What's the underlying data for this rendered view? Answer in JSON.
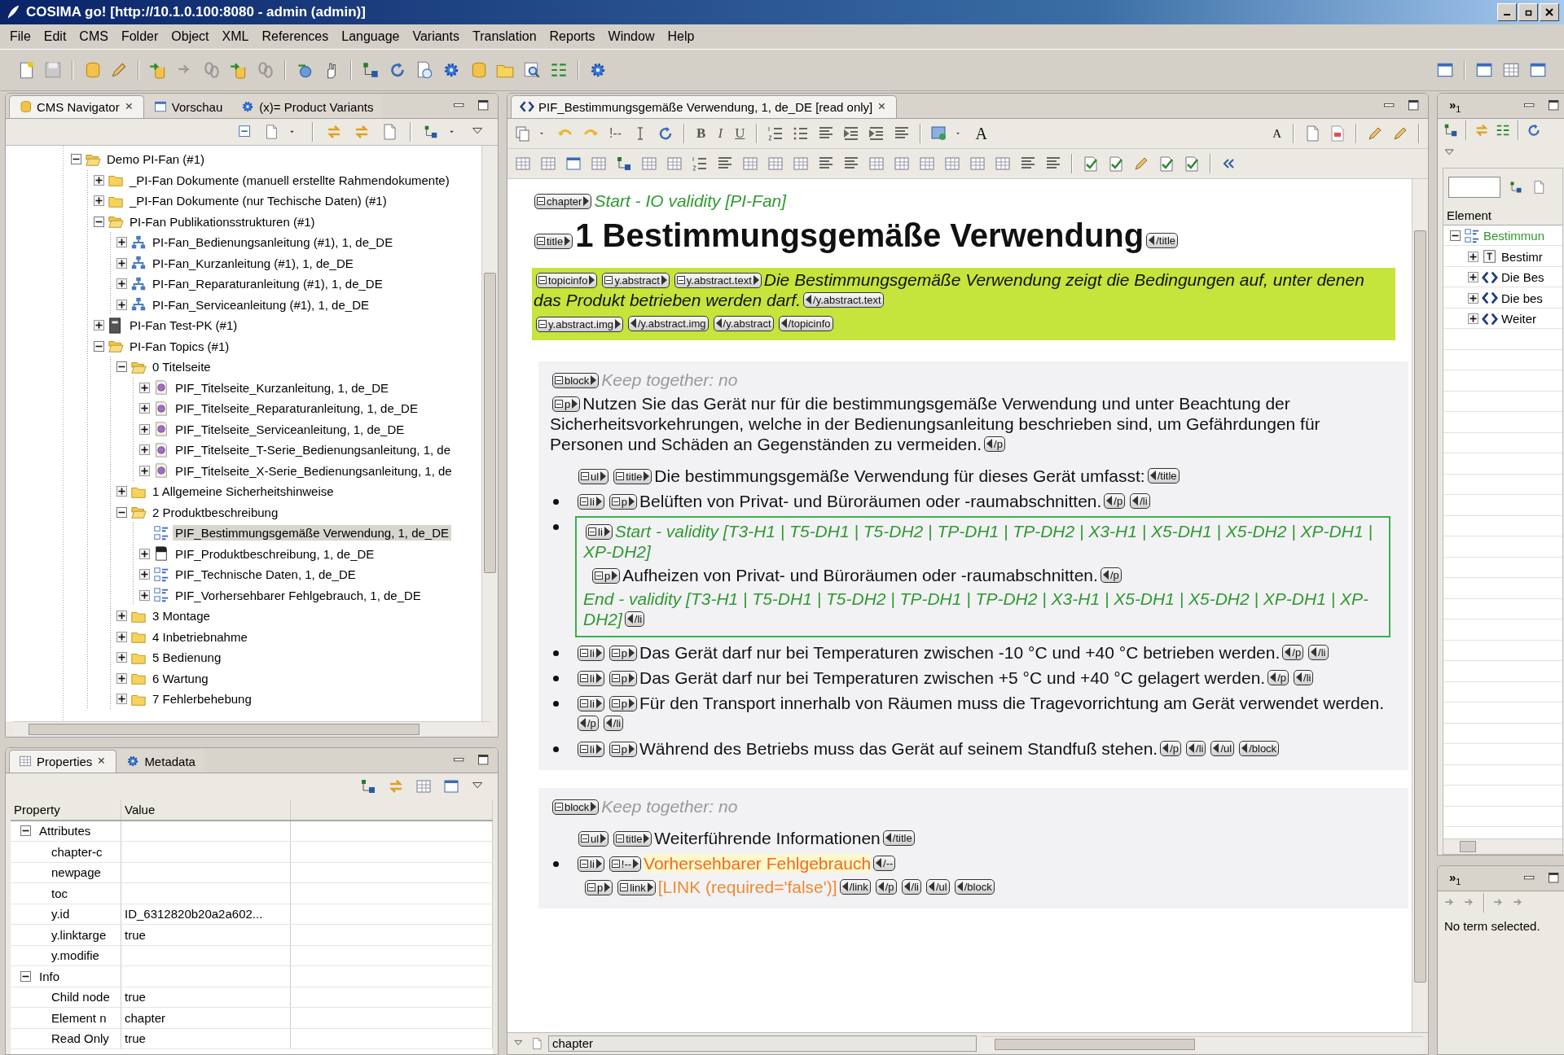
{
  "window": {
    "title": "COSIMA go! [http://10.1.0.100:8080 - admin (admin)]"
  },
  "menu": [
    "File",
    "Edit",
    "CMS",
    "Folder",
    "Object",
    "XML",
    "References",
    "Language",
    "Variants",
    "Translation",
    "Reports",
    "Window",
    "Help"
  ],
  "navigator": {
    "tabs": [
      {
        "label": "CMS Navigator",
        "selected": true
      },
      {
        "label": "Vorschau",
        "selected": false
      },
      {
        "label": "(x)= Product Variants",
        "selected": false
      }
    ],
    "tree": [
      {
        "label": "Demo PI-Fan (#1)",
        "kind": "folder",
        "expandable": true,
        "expanded": true,
        "selected": false,
        "children": [
          {
            "label": "_PI-Fan Dokumente (manuell erstellte Rahmendokumente)",
            "kind": "folder",
            "expandable": true,
            "expanded": false,
            "selected": false
          },
          {
            "label": "_PI-Fan Dokumente (nur Techische Daten) (#1)",
            "kind": "folder",
            "expandable": true,
            "expanded": false,
            "selected": false
          },
          {
            "label": "PI-Fan Publikationsstrukturen (#1)",
            "kind": "folder",
            "expandable": true,
            "expanded": true,
            "selected": false,
            "children": [
              {
                "label": "PI-Fan_Bedienungsanleitung (#1), 1, de_DE",
                "kind": "structure",
                "expandable": true,
                "expanded": false,
                "selected": false
              },
              {
                "label": "PI-Fan_Kurzanleitung (#1), 1, de_DE",
                "kind": "structure",
                "expandable": true,
                "expanded": false,
                "selected": false
              },
              {
                "label": "PI-Fan_Reparaturanleitung (#1), 1, de_DE",
                "kind": "structure",
                "expandable": true,
                "expanded": false,
                "selected": false
              },
              {
                "label": "PI-Fan_Serviceanleitung (#1), 1, de_DE",
                "kind": "structure",
                "expandable": true,
                "expanded": false,
                "selected": false
              }
            ]
          },
          {
            "label": "PI-Fan Test-PK (#1)",
            "kind": "binder",
            "expandable": true,
            "expanded": false,
            "selected": false
          },
          {
            "label": "PI-Fan Topics (#1)",
            "kind": "folder",
            "expandable": true,
            "expanded": true,
            "selected": false,
            "children": [
              {
                "label": "0 Titelseite",
                "kind": "folder",
                "expandable": true,
                "expanded": true,
                "selected": false,
                "children": [
                  {
                    "label": "PIF_Titelseite_Kurzanleitung, 1, de_DE",
                    "kind": "topic",
                    "expandable": true,
                    "expanded": false,
                    "selected": false
                  },
                  {
                    "label": "PIF_Titelseite_Reparaturanleitung, 1, de_DE",
                    "kind": "topic",
                    "expandable": true,
                    "expanded": false,
                    "selected": false
                  },
                  {
                    "label": "PIF_Titelseite_Serviceanleitung, 1, de_DE",
                    "kind": "topic",
                    "expandable": true,
                    "expanded": false,
                    "selected": false
                  },
                  {
                    "label": "PIF_Titelseite_T-Serie_Bedienungsanleitung, 1, de",
                    "kind": "topic",
                    "expandable": true,
                    "expanded": false,
                    "selected": false
                  },
                  {
                    "label": "PIF_Titelseite_X-Serie_Bedienungsanleitung, 1, de",
                    "kind": "topic",
                    "expandable": true,
                    "expanded": false,
                    "selected": false
                  }
                ]
              },
              {
                "label": "1 Allgemeine Sicherheitshinweise",
                "kind": "folder",
                "expandable": true,
                "expanded": false,
                "selected": false
              },
              {
                "label": "2 Produktbeschreibung",
                "kind": "folder",
                "expandable": true,
                "expanded": true,
                "selected": false,
                "children": [
                  {
                    "label": "PIF_Bestimmungsgemäße Verwendung, 1, de_DE",
                    "kind": "outline",
                    "expandable": false,
                    "selected": true
                  },
                  {
                    "label": "PIF_Produktbeschreibung, 1, de_DE",
                    "kind": "document",
                    "expandable": true,
                    "expanded": false,
                    "selected": false
                  },
                  {
                    "label": "PIF_Technische Daten, 1, de_DE",
                    "kind": "outline",
                    "expandable": true,
                    "expanded": false,
                    "selected": false
                  },
                  {
                    "label": "PIF_Vorhersehbarer Fehlgebrauch, 1, de_DE",
                    "kind": "outline",
                    "expandable": true,
                    "expanded": false,
                    "selected": false
                  }
                ]
              },
              {
                "label": "3 Montage",
                "kind": "folder",
                "expandable": true,
                "expanded": false,
                "selected": false
              },
              {
                "label": "4 Inbetriebnahme",
                "kind": "folder",
                "expandable": true,
                "expanded": false,
                "selected": false
              },
              {
                "label": "5 Bedienung",
                "kind": "folder",
                "expandable": true,
                "expanded": false,
                "selected": false
              },
              {
                "label": "6 Wartung",
                "kind": "folder",
                "expandable": true,
                "expanded": false,
                "selected": false
              },
              {
                "label": "7 Fehlerbehebung",
                "kind": "folder",
                "expandable": true,
                "expanded": false,
                "selected": false
              }
            ]
          }
        ]
      }
    ]
  },
  "properties": {
    "tabs": [
      {
        "label": "Properties",
        "selected": true
      },
      {
        "label": "Metadata",
        "selected": false
      }
    ],
    "columns": [
      "Property",
      "Value"
    ],
    "rows": [
      {
        "kind": "group",
        "name": "Attributes",
        "expanded": true
      },
      {
        "kind": "prop",
        "name": "chapter-c"
      },
      {
        "kind": "prop",
        "name": "newpage"
      },
      {
        "kind": "prop",
        "name": "toc"
      },
      {
        "kind": "prop",
        "name": "y.id",
        "value": "ID_6312820b20a2a602..."
      },
      {
        "kind": "prop",
        "name": "y.linktarge",
        "value": "true"
      },
      {
        "kind": "prop",
        "name": "y.modifie"
      },
      {
        "kind": "group",
        "name": "Info",
        "expanded": true
      },
      {
        "kind": "prop",
        "name": "Child node",
        "value": "true"
      },
      {
        "kind": "prop",
        "name": "Element n",
        "value": "chapter"
      },
      {
        "kind": "prop",
        "name": "Read Only",
        "value": "true"
      }
    ]
  },
  "editor": {
    "tab": {
      "label": "PIF_Bestimmungsgemäße Verwendung, 1, de_DE [read only]",
      "selected": true
    },
    "toolbar_text": [
      {
        "label": "!--",
        "kind": "comment"
      },
      {
        "label": "B",
        "kind": "bold"
      },
      {
        "label": "I",
        "kind": "italic"
      },
      {
        "label": "U",
        "kind": "underline"
      },
      {
        "label": "A",
        "kind": "grow"
      },
      {
        "label": "A",
        "kind": "shrink"
      }
    ],
    "blocks": [
      {
        "kind": "plain",
        "lines": [
          {
            "kind": "para",
            "segments": [
              {
                "kind": "open_tag",
                "label": "chapter"
              },
              {
                "kind": "condition",
                "text": "Start - IO validity [PI-Fan]"
              }
            ]
          },
          {
            "kind": "para",
            "segments": [
              {
                "kind": "open_tag",
                "label": "title"
              },
              {
                "kind": "heading",
                "text": "1 Bestimmungsgemäße Verwendung"
              },
              {
                "kind": "close_tag",
                "label": "/title"
              }
            ]
          }
        ]
      },
      {
        "kind": "abstract",
        "lines": [
          {
            "kind": "para",
            "segments": [
              {
                "kind": "open_tag",
                "label": "topicinfo"
              },
              {
                "kind": "open_tag",
                "label": "y.abstract"
              },
              {
                "kind": "open_tag",
                "label": "y.abstract.text"
              },
              {
                "kind": "abstract",
                "text": "Die Bestimmungsgemäße Verwendung zeigt die Bedingungen auf, unter denen das Produkt betrieben werden darf."
              },
              {
                "kind": "close_tag",
                "label": "/y.abstract.text"
              }
            ]
          },
          {
            "kind": "para",
            "segments": [
              {
                "kind": "open_tag",
                "label": "y.abstract.img"
              },
              {
                "kind": "close_tag",
                "label": "/y.abstract.img"
              },
              {
                "kind": "close_tag",
                "label": "/y.abstract"
              },
              {
                "kind": "close_tag",
                "label": "/topicinfo"
              }
            ]
          }
        ]
      },
      {
        "kind": "block",
        "lines": [
          {
            "kind": "para",
            "segments": [
              {
                "kind": "open_tag",
                "label": "block"
              },
              {
                "kind": "hint",
                "text": "Keep together: no"
              }
            ]
          },
          {
            "kind": "para",
            "segments": [
              {
                "kind": "open_tag",
                "label": "p"
              },
              {
                "kind": "body",
                "text": "Nutzen Sie das Gerät nur für die bestimmungsgemäße Verwendung und unter Beachtung der Sicherheitsvorkehrungen, welche in der Bedienungsanleitung beschrieben sind, um Gefährdungen für Personen und Schäden an Gegenständen zu vermeiden."
              },
              {
                "kind": "close_tag",
                "label": "/p"
              }
            ]
          },
          {
            "kind": "list_title",
            "segments": [
              {
                "kind": "open_tag",
                "label": "ul"
              },
              {
                "kind": "open_tag",
                "label": "title"
              },
              {
                "kind": "body",
                "text": "Die bestimmungsgemäße Verwendung für dieses Gerät umfasst:"
              },
              {
                "kind": "close_tag",
                "label": "/title"
              }
            ]
          },
          {
            "kind": "item",
            "segments": [
              {
                "kind": "open_tag",
                "label": "li"
              },
              {
                "kind": "open_tag",
                "label": "p"
              },
              {
                "kind": "body",
                "text": "Belüften von Privat- und Büroräumen oder -raumabschnitten."
              },
              {
                "kind": "close_tag",
                "label": "/p"
              },
              {
                "kind": "close_tag",
                "label": "/li"
              }
            ]
          },
          {
            "kind": "validity",
            "lines": [
              {
                "kind": "para",
                "segments": [
                  {
                    "kind": "open_tag",
                    "label": "li"
                  },
                  {
                    "kind": "condition",
                    "text": "Start - validity [T3-H1 | T5-DH1 | T5-DH2 | TP-DH1 | TP-DH2 | X3-H1 | X5-DH1 | X5-DH2 | XP-DH1 | XP-DH2]"
                  }
                ]
              },
              {
                "kind": "item_cont",
                "segments": [
                  {
                    "kind": "open_tag",
                    "label": "p"
                  },
                  {
                    "kind": "body",
                    "text": "Aufheizen von Privat- und Büroräumen oder -raumabschnitten."
                  },
                  {
                    "kind": "close_tag",
                    "label": "/p"
                  }
                ]
              },
              {
                "kind": "para",
                "segments": [
                  {
                    "kind": "condition",
                    "text": "End - validity [T3-H1 | T5-DH1 | T5-DH2 | TP-DH1 | TP-DH2 | X3-H1 | X5-DH1 | X5-DH2 | XP-DH1 | XP-DH2]"
                  },
                  {
                    "kind": "close_tag",
                    "label": "/li"
                  }
                ]
              }
            ]
          },
          {
            "kind": "item",
            "segments": [
              {
                "kind": "open_tag",
                "label": "li"
              },
              {
                "kind": "open_tag",
                "label": "p"
              },
              {
                "kind": "body",
                "text": "Das Gerät darf nur bei Temperaturen zwischen -10 °C und +40 °C betrieben werden."
              },
              {
                "kind": "close_tag",
                "label": "/p"
              },
              {
                "kind": "close_tag",
                "label": "/li"
              }
            ]
          },
          {
            "kind": "item",
            "segments": [
              {
                "kind": "open_tag",
                "label": "li"
              },
              {
                "kind": "open_tag",
                "label": "p"
              },
              {
                "kind": "body",
                "text": "Das Gerät darf nur bei Temperaturen zwischen +5 °C und +40 °C gelagert werden."
              },
              {
                "kind": "close_tag",
                "label": "/p"
              },
              {
                "kind": "close_tag",
                "label": "/li"
              }
            ]
          },
          {
            "kind": "item",
            "segments": [
              {
                "kind": "open_tag",
                "label": "li"
              },
              {
                "kind": "open_tag",
                "label": "p"
              },
              {
                "kind": "body",
                "text": "Für den Transport innerhalb von Räumen muss die Tragevorrichtung am Gerät verwendet werden."
              },
              {
                "kind": "close_tag",
                "label": "/p"
              },
              {
                "kind": "close_tag",
                "label": "/li"
              }
            ]
          },
          {
            "kind": "item",
            "segments": [
              {
                "kind": "open_tag",
                "label": "li"
              },
              {
                "kind": "open_tag",
                "label": "p"
              },
              {
                "kind": "body",
                "text": "Während des Betriebs muss das Gerät auf seinem Standfuß stehen."
              },
              {
                "kind": "close_tag",
                "label": "/p"
              },
              {
                "kind": "close_tag",
                "label": "/li"
              },
              {
                "kind": "close_tag",
                "label": "/ul"
              },
              {
                "kind": "close_tag",
                "label": "/block"
              }
            ]
          }
        ]
      },
      {
        "kind": "block",
        "lines": [
          {
            "kind": "para",
            "segments": [
              {
                "kind": "open_tag",
                "label": "block"
              },
              {
                "kind": "hint",
                "text": "Keep together: no"
              }
            ]
          },
          {
            "kind": "list_title",
            "segments": [
              {
                "kind": "open_tag",
                "label": "ul"
              },
              {
                "kind": "open_tag",
                "label": "title"
              },
              {
                "kind": "body",
                "text": "Weiterführende Informationen"
              },
              {
                "kind": "close_tag",
                "label": "/title"
              }
            ]
          },
          {
            "kind": "item",
            "segments": [
              {
                "kind": "open_tag",
                "label": "li"
              },
              {
                "kind": "open_tag",
                "label": "!--"
              },
              {
                "kind": "comment",
                "text": "Vorhersehbarer Fehlgebrauch"
              },
              {
                "kind": "close_tag",
                "label": "/--"
              }
            ]
          },
          {
            "kind": "item_cont",
            "segments": [
              {
                "kind": "open_tag",
                "label": "p"
              },
              {
                "kind": "open_tag",
                "label": "link"
              },
              {
                "kind": "link",
                "text": "[LINK (required='false')]"
              },
              {
                "kind": "close_tag",
                "label": "/link"
              },
              {
                "kind": "close_tag",
                "label": "/p"
              },
              {
                "kind": "close_tag",
                "label": "/li"
              },
              {
                "kind": "close_tag",
                "label": "/ul"
              },
              {
                "kind": "close_tag",
                "label": "/block"
              }
            ]
          }
        ]
      }
    ],
    "breadcrumb": "chapter"
  },
  "outline": {
    "overflow": {
      "glyph": "»",
      "count": "1"
    },
    "column": "Element",
    "tree": [
      {
        "label": "Bestimmun",
        "kind": "outline",
        "expanded": true,
        "children": [
          {
            "label": "Bestimr",
            "kind": "title",
            "expanded": false
          },
          {
            "label": "Die Bes",
            "kind": "element",
            "expanded": false
          },
          {
            "label": "Die bes",
            "kind": "element",
            "expanded": false
          },
          {
            "label": "Weiter",
            "kind": "element",
            "expanded": false
          }
        ]
      }
    ]
  },
  "terms": {
    "overflow": {
      "glyph": "»",
      "count": "1"
    },
    "message": "No term selected."
  }
}
